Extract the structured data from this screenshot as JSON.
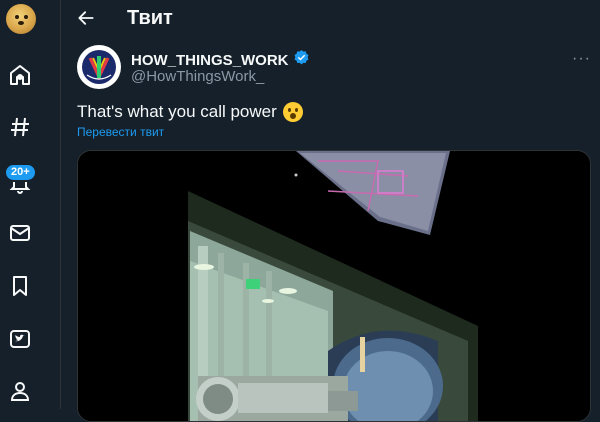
{
  "header": {
    "title": "Твит"
  },
  "sidebar": {
    "notifications_badge": "20+",
    "items": [
      {
        "name": "home",
        "icon": "home-icon"
      },
      {
        "name": "explore",
        "icon": "hashtag-icon"
      },
      {
        "name": "notifications",
        "icon": "bell-icon"
      },
      {
        "name": "messages",
        "icon": "envelope-icon"
      },
      {
        "name": "bookmarks",
        "icon": "bookmark-icon"
      },
      {
        "name": "twitter-blue",
        "icon": "twitter-blue-icon"
      },
      {
        "name": "profile",
        "icon": "person-icon"
      }
    ]
  },
  "tweet": {
    "author_name": "HOW_THINGS_WORK",
    "author_handle": "@HowThingsWork_",
    "text": "That's what you call power",
    "emoji": "astonished-face",
    "translate_link": "Перевести твит",
    "verified": true
  },
  "colors": {
    "background": "#15202b",
    "accent": "#1d9bf0",
    "muted": "#8b98a5"
  }
}
